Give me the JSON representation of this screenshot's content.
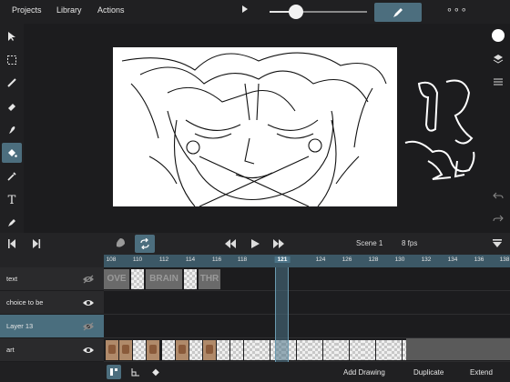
{
  "menu": {
    "projects": "Projects",
    "library": "Library",
    "actions": "Actions"
  },
  "toolbar": {
    "tools": [
      "select-tool",
      "marquee-tool",
      "brush-tool",
      "eraser-tool",
      "smudge-tool",
      "fill-tool",
      "eyedropper-tool",
      "text-tool",
      "pen-tool"
    ],
    "active_tool": "fill-tool"
  },
  "right_toolbar": {
    "color": "#ffffff",
    "icons": [
      "color-swatch",
      "layers-icon",
      "adjust-icon",
      "undo-icon",
      "redo-icon"
    ]
  },
  "playback": {
    "scene": "Scene 1",
    "fps": "8 fps"
  },
  "ruler": {
    "ticks": [
      "108",
      "110",
      "112",
      "114",
      "116",
      "118",
      "121",
      "124",
      "126",
      "128",
      "130",
      "132",
      "134",
      "136",
      "138"
    ],
    "current": "121"
  },
  "layers": [
    {
      "name": "text",
      "visible": false,
      "selected": false
    },
    {
      "name": "choice to be",
      "visible": true,
      "selected": false
    },
    {
      "name": "Layer 13",
      "visible": false,
      "selected": true
    },
    {
      "name": "art",
      "visible": true,
      "selected": false
    }
  ],
  "text_track_words": [
    "OVE",
    "BRAIN",
    "THR"
  ],
  "bottom_actions": {
    "add_drawing": "Add Drawing",
    "duplicate": "Duplicate",
    "extend": "Extend"
  },
  "colors": {
    "accent": "#4c6e7e",
    "background": "#1c1c1e",
    "ruler": "#3c5866"
  }
}
